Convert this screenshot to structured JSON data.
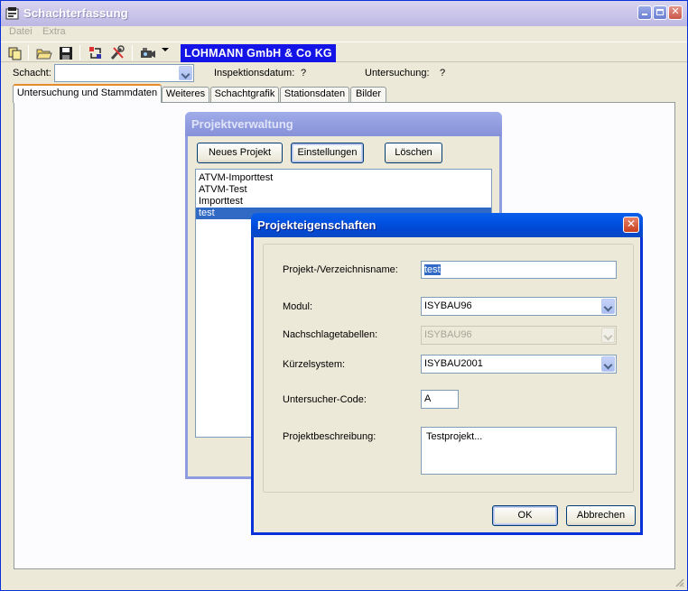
{
  "window": {
    "title": "Schachterfassung"
  },
  "menu": {
    "items": [
      "Datei",
      "Extra"
    ]
  },
  "toolbar": {
    "brand": "LOHMANN GmbH & Co KG"
  },
  "header": {
    "schacht_label": "Schacht:",
    "schacht_value": "",
    "inspektionsdatum_label": "Inspektionsdatum:",
    "inspektionsdatum_value": "?",
    "untersuchung_label": "Untersuchung:",
    "untersuchung_value": "?"
  },
  "tabs": [
    {
      "label": "Untersuchung und Stammdaten"
    },
    {
      "label": "Weiteres"
    },
    {
      "label": "Schachtgrafik"
    },
    {
      "label": "Stationsdaten"
    },
    {
      "label": "Bilder"
    }
  ],
  "projektverwaltung": {
    "title": "Projektverwaltung",
    "buttons": {
      "new": "Neues Projekt",
      "settings": "Einstellungen",
      "delete": "Löschen"
    },
    "projects": [
      "ATVM-Importtest",
      "ATVM-Test",
      "Importtest",
      "test"
    ],
    "selected_index": 3
  },
  "projekteigenschaften": {
    "title": "Projekteigenschaften",
    "fields": {
      "name_label": "Projekt-/Verzeichnisname:",
      "name_value": "test",
      "modul_label": "Modul:",
      "modul_value": "ISYBAU96",
      "nachschlage_label": "Nachschlagetabellen:",
      "nachschlage_value": "ISYBAU96",
      "kuerzel_label": "Kürzelsystem:",
      "kuerzel_value": "ISYBAU2001",
      "code_label": "Untersucher-Code:",
      "code_value": "A",
      "beschreibung_label": "Projektbeschreibung:",
      "beschreibung_value": "Testprojekt..."
    },
    "buttons": {
      "ok": "OK",
      "cancel": "Abbrechen"
    }
  },
  "colors": {
    "window_face": "#ece9d8",
    "selection": "#316ac5",
    "brand_bg": "#1414e6",
    "active_caption": "#0355e6",
    "inactive_caption": "#8f9ce0",
    "tab_accent": "#e68b2c"
  },
  "icons": {
    "app": "app-icon",
    "toolbar": [
      "copy-icon",
      "open-folder-icon",
      "save-icon",
      "transfer-icon",
      "tools-icon",
      "camera-icon",
      "dropdown-arrow-icon"
    ]
  }
}
